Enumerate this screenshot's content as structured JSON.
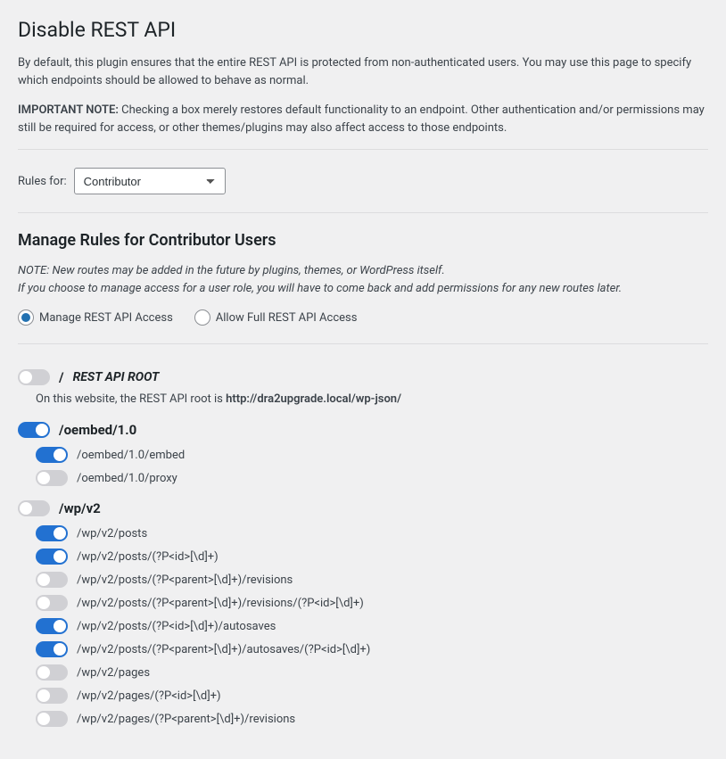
{
  "page_title": "Disable REST API",
  "intro_paragraph": "By default, this plugin ensures that the entire REST API is protected from non-authenticated users. You may use this page to specify which endpoints should be allowed to behave as normal.",
  "important_note_label": "IMPORTANT NOTE:",
  "important_note_text": " Checking a box merely restores default functionality to an endpoint. Other authentication and/or permissions may still be required for access, or other themes/plugins may also affect access to those endpoints.",
  "rules_for_label": "Rules for:",
  "selected_role": "Contributor",
  "manage_heading": "Manage Rules for Contributor Users",
  "routes_note_line1": "NOTE: New routes may be added in the future by plugins, themes, or WordPress itself.",
  "routes_note_line2": "If you choose to manage access for a user role, you will have to come back and add permissions for any new routes later.",
  "radio_manage_label": "Manage REST API Access",
  "radio_full_label": "Allow Full REST API Access",
  "radio_selected": "manage",
  "root": {
    "slash": "/",
    "label": "REST API ROOT",
    "enabled": false,
    "info_prefix": "On this website, the REST API root is ",
    "info_url": "http://dra2upgrade.local/wp-json/"
  },
  "namespaces": [
    {
      "label": "/oembed/1.0",
      "enabled": true,
      "routes": [
        {
          "label": "/oembed/1.0/embed",
          "enabled": true
        },
        {
          "label": "/oembed/1.0/proxy",
          "enabled": false
        }
      ]
    },
    {
      "label": "/wp/v2",
      "enabled": false,
      "routes": [
        {
          "label": "/wp/v2/posts",
          "enabled": true
        },
        {
          "label": "/wp/v2/posts/(?P<id>[\\d]+)",
          "enabled": true
        },
        {
          "label": "/wp/v2/posts/(?P<parent>[\\d]+)/revisions",
          "enabled": false
        },
        {
          "label": "/wp/v2/posts/(?P<parent>[\\d]+)/revisions/(?P<id>[\\d]+)",
          "enabled": false
        },
        {
          "label": "/wp/v2/posts/(?P<id>[\\d]+)/autosaves",
          "enabled": true
        },
        {
          "label": "/wp/v2/posts/(?P<parent>[\\d]+)/autosaves/(?P<id>[\\d]+)",
          "enabled": true
        },
        {
          "label": "/wp/v2/pages",
          "enabled": false
        },
        {
          "label": "/wp/v2/pages/(?P<id>[\\d]+)",
          "enabled": false
        },
        {
          "label": "/wp/v2/pages/(?P<parent>[\\d]+)/revisions",
          "enabled": false
        }
      ]
    }
  ]
}
